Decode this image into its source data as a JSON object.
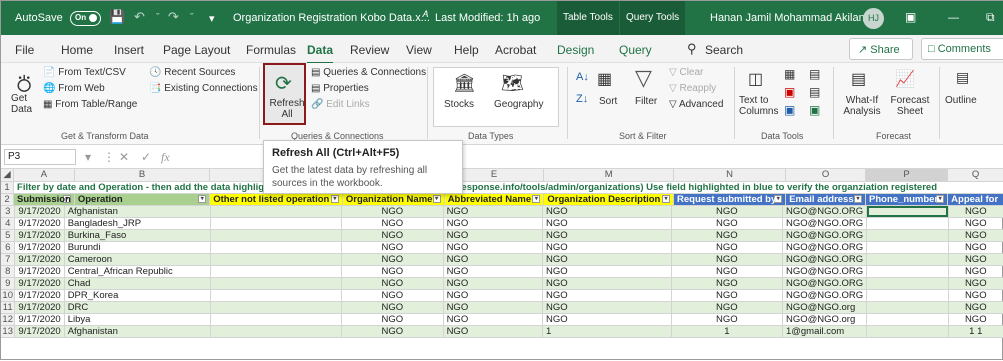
{
  "titlebar": {
    "autosave": "AutoSave",
    "autosave_state": "On",
    "doc_title": "Organization Registration Kobo Data.x...",
    "modified": "Last Modified: 1h ago",
    "context_tabs": [
      "Table Tools",
      "Query Tools"
    ],
    "user": "Hanan Jamil Mohammad Akilan",
    "initials": "HJ"
  },
  "tabs": [
    "File",
    "Home",
    "Insert",
    "Page Layout",
    "Formulas",
    "Data",
    "Review",
    "View",
    "Help",
    "Acrobat",
    "Design",
    "Query"
  ],
  "search": "Search",
  "share": "Share",
  "comments": "Comments",
  "ribbon": {
    "get_data": "Get Data",
    "from_text": "From Text/CSV",
    "from_web": "From Web",
    "from_table": "From Table/Range",
    "recent_sources": "Recent Sources",
    "existing": "Existing Connections",
    "g1": "Get & Transform Data",
    "refresh_all": "Refresh All",
    "queries": "Queries & Connections",
    "properties": "Properties",
    "edit_links": "Edit Links",
    "g2": "Queries & Connections",
    "stocks": "Stocks",
    "geography": "Geography",
    "g3": "Data Types",
    "sort": "Sort",
    "filter": "Filter",
    "clear": "Clear",
    "reapply": "Reapply",
    "advanced": "Advanced",
    "g4": "Sort & Filter",
    "text_to_columns": "Text to Columns",
    "g5": "Data Tools",
    "whatif": "What-If Analysis",
    "forecast_sheet": "Forecast Sheet",
    "g6": "Forecast",
    "outline": "Outline"
  },
  "tooltip": {
    "title": "Refresh All (Ctrl+Alt+F5)",
    "desc": "Get the latest data by refreshing all sources in the workbook."
  },
  "namebox": "P3",
  "fx": "fx",
  "columns": [
    "A",
    "B",
    "",
    "",
    "E",
    "M",
    "N",
    "O",
    "P",
    "Q"
  ],
  "note_row": "Filter by date and Operation - then add the data highlighted in yellow to https://kobo.humanitarianresponse.info/tools/admin/organizations) Use field highlighted in blue to verify the organziation registered",
  "headers": [
    "Submission",
    "Operation",
    "Other not listed operation",
    "Organization Name",
    "Abbreviated Name",
    "Organization Description",
    "Request submitted by",
    "Email address",
    "Phone_number",
    "Appeal for"
  ],
  "rows": [
    {
      "n": "3",
      "date": "9/17/2020",
      "op": "Afghanistan",
      "org": "NGO",
      "abbr": "NGO",
      "desc": "NGO",
      "req": "NGO",
      "email": "NGO@NGO.ORG",
      "appeal": "NGO"
    },
    {
      "n": "4",
      "date": "9/17/2020",
      "op": "Bangladesh_JRP",
      "org": "NGO",
      "abbr": "NGO",
      "desc": "NGO",
      "req": "NGO",
      "email": "NGO@NGO.ORG",
      "appeal": "NGO"
    },
    {
      "n": "5",
      "date": "9/17/2020",
      "op": "Burkina_Faso",
      "org": "NGO",
      "abbr": "NGO",
      "desc": "NGO",
      "req": "NGO",
      "email": "NGO@NGO.ORG",
      "appeal": "NGO"
    },
    {
      "n": "6",
      "date": "9/17/2020",
      "op": "Burundi",
      "org": "NGO",
      "abbr": "NGO",
      "desc": "NGO",
      "req": "NGO",
      "email": "NGO@NGO.ORG",
      "appeal": "NGO"
    },
    {
      "n": "7",
      "date": "9/17/2020",
      "op": "Cameroon",
      "org": "NGO",
      "abbr": "NGO",
      "desc": "NGO",
      "req": "NGO",
      "email": "NGO@NGO.ORG",
      "appeal": "NGO"
    },
    {
      "n": "8",
      "date": "9/17/2020",
      "op": "Central_African Republic",
      "org": "NGO",
      "abbr": "NGO",
      "desc": "NGO",
      "req": "NGO",
      "email": "NGO@NGO.ORG",
      "appeal": "NGO"
    },
    {
      "n": "9",
      "date": "9/17/2020",
      "op": "Chad",
      "org": "NGO",
      "abbr": "NGO",
      "desc": "NGO",
      "req": "NGO",
      "email": "NGO@NGO.ORG",
      "appeal": "NGO"
    },
    {
      "n": "10",
      "date": "9/17/2020",
      "op": "DPR_Korea",
      "org": "NGO",
      "abbr": "NGO",
      "desc": "NGO",
      "req": "NGO",
      "email": "NGO@NGO.ORG",
      "appeal": "NGO"
    },
    {
      "n": "11",
      "date": "9/17/2020",
      "op": "DRC",
      "org": "NGO",
      "abbr": "NGO",
      "desc": "NGO",
      "req": "NGO",
      "email": "NGO@NGO.org",
      "appeal": "NGO"
    },
    {
      "n": "12",
      "date": "9/17/2020",
      "op": "Libya",
      "org": "NGO",
      "abbr": "NGO",
      "desc": "NGO",
      "req": "NGO",
      "email": "NGO@NGO.org",
      "appeal": "NGO"
    },
    {
      "n": "13",
      "date": "9/17/2020",
      "op": "Afghanistan",
      "org": "NGO",
      "abbr": "NGO",
      "desc": "1",
      "req": "1",
      "email": "1@gmail.com",
      "appeal": "1 1"
    }
  ],
  "colors": {
    "accent": "#217346",
    "refresh_border": "#8b1a1a",
    "yellow": "#ffff00",
    "blue": "#4472c4"
  }
}
